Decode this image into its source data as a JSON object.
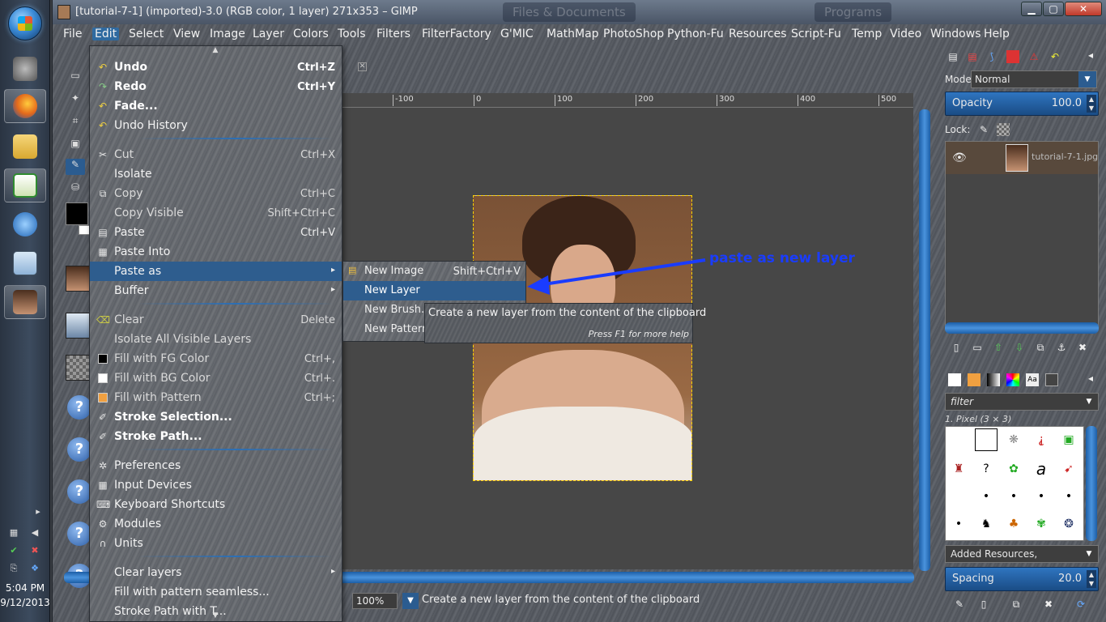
{
  "taskbar": {
    "clock_time": "5:04 PM",
    "clock_date": "9/12/2013"
  },
  "window": {
    "title": "[tutorial-7-1] (imported)-3.0 (RGB color, 1 layer) 271x353 – GIMP",
    "ghost_tabs": [
      "Files & Documents",
      "Programs"
    ]
  },
  "menubar": {
    "items": [
      "File",
      "Edit",
      "Select",
      "View",
      "Image",
      "Layer",
      "Colors",
      "Tools",
      "Filters",
      "FilterFactory",
      "G'MIC",
      "MathMap",
      "PhotoShop",
      "Python-Fu",
      "Resources",
      "Script-Fu",
      "Temp",
      "Video",
      "Windows",
      "Help"
    ]
  },
  "edit_menu": {
    "items": [
      {
        "label": "Undo",
        "shortcut": "Ctrl+Z",
        "icon": "undo-icon"
      },
      {
        "label": "Redo",
        "shortcut": "Ctrl+Y",
        "icon": "redo-icon"
      },
      {
        "label": "Fade...",
        "shortcut": "",
        "icon": "fade-icon"
      },
      {
        "label": "Undo History",
        "shortcut": "",
        "icon": "undo-history-icon"
      },
      {
        "label": "Cut",
        "shortcut": "Ctrl+X",
        "icon": "scissors-icon"
      },
      {
        "label": "Isolate",
        "shortcut": "",
        "icon": ""
      },
      {
        "label": "Copy",
        "shortcut": "Ctrl+C",
        "icon": "copy-icon"
      },
      {
        "label": "Copy Visible",
        "shortcut": "Shift+Ctrl+C",
        "icon": ""
      },
      {
        "label": "Paste",
        "shortcut": "Ctrl+V",
        "icon": "paste-icon"
      },
      {
        "label": "Paste Into",
        "shortcut": "",
        "icon": "paste-into-icon"
      },
      {
        "label": "Paste as",
        "shortcut": "",
        "icon": ""
      },
      {
        "label": "Buffer",
        "shortcut": "",
        "icon": ""
      },
      {
        "label": "Clear",
        "shortcut": "Delete",
        "icon": "clear-icon"
      },
      {
        "label": "Isolate All Visible Layers",
        "shortcut": "",
        "icon": ""
      },
      {
        "label": "Fill with FG Color",
        "shortcut": "Ctrl+,",
        "icon": "fg-swatch-icon"
      },
      {
        "label": "Fill with BG Color",
        "shortcut": "Ctrl+.",
        "icon": "bg-swatch-icon"
      },
      {
        "label": "Fill with Pattern",
        "shortcut": "Ctrl+;",
        "icon": "pattern-swatch-icon"
      },
      {
        "label": "Stroke Selection...",
        "shortcut": "",
        "icon": "stroke-selection-icon"
      },
      {
        "label": "Stroke Path...",
        "shortcut": "",
        "icon": "stroke-path-icon"
      },
      {
        "label": "Preferences",
        "shortcut": "",
        "icon": "preferences-icon"
      },
      {
        "label": "Input Devices",
        "shortcut": "",
        "icon": "input-devices-icon"
      },
      {
        "label": "Keyboard Shortcuts",
        "shortcut": "",
        "icon": "keyboard-icon"
      },
      {
        "label": "Modules",
        "shortcut": "",
        "icon": "modules-icon"
      },
      {
        "label": "Units",
        "shortcut": "",
        "icon": "units-icon"
      },
      {
        "label": "Clear layers",
        "shortcut": "",
        "icon": ""
      },
      {
        "label": "Fill with pattern seamless...",
        "shortcut": "",
        "icon": ""
      },
      {
        "label": "Stroke Path with T...",
        "shortcut": "",
        "icon": ""
      }
    ]
  },
  "paste_as_menu": {
    "items": [
      {
        "label": "New Image",
        "shortcut": "Shift+Ctrl+V"
      },
      {
        "label": "New Layer",
        "shortcut": ""
      },
      {
        "label": "New Brush...",
        "shortcut": ""
      },
      {
        "label": "New Pattern...",
        "shortcut": ""
      }
    ]
  },
  "tooltip": {
    "text": "Create a new layer from the content of the clipboard",
    "help": "Press F1 for more help"
  },
  "annotation": {
    "text": "paste as new layer",
    "color": "#1a3cff"
  },
  "ruler": {
    "labels": [
      "-100",
      "0",
      "100",
      "200",
      "300",
      "400",
      "500"
    ]
  },
  "statusbar": {
    "zoom": "100",
    "zoom_unit": "%",
    "message": "Create a new layer from the content of the clipboard"
  },
  "dock": {
    "mode_label": "Mode:",
    "mode_value": "Normal",
    "opacity_label": "Opacity",
    "opacity_value": "100.0",
    "lock_label": "Lock:",
    "layer_name": "tutorial-7-1.jpg",
    "filter_placeholder": "filter",
    "brush_label": "1. Pixel (3 × 3)",
    "added_resources": "Added Resources,",
    "spacing_label": "Spacing",
    "spacing_value": "20.0"
  }
}
